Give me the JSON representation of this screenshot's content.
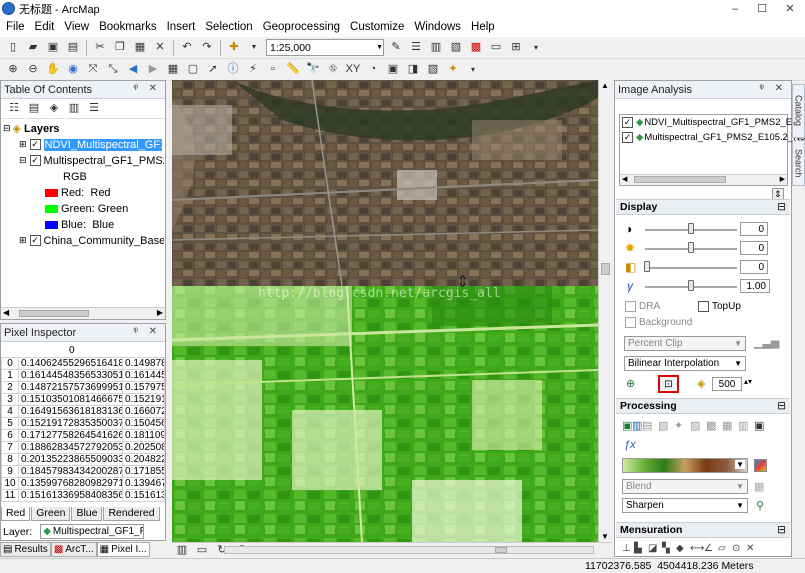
{
  "window": {
    "title": "无标题 - ArcMap",
    "min": "–",
    "max": "☐",
    "close": "✕"
  },
  "menu": [
    "File",
    "Edit",
    "View",
    "Bookmarks",
    "Insert",
    "Selection",
    "Geoprocessing",
    "Customize",
    "Windows",
    "Help"
  ],
  "toolbar": {
    "scale": "1:25,000"
  },
  "toc": {
    "title": "Table Of Contents",
    "layers_label": "Layers",
    "layer1": "NDVI_Multispectral_GF1_P",
    "layer2": "Multispectral_GF1_PMS2_E",
    "rgb": "RGB",
    "red": "Red:",
    "red_val": "Red",
    "green": "Green:",
    "green_val": "Green",
    "blue": "Blue:",
    "blue_val": "Blue",
    "layer3": "China_Community_BaseMa",
    "colors": {
      "red": "#ff0000",
      "green": "#00ff00",
      "blue": "#0000ff"
    }
  },
  "pixel": {
    "title": "Pixel Inspector",
    "col0": "0",
    "rows": [
      [
        "0",
        "0.1406245529651641​8",
        "0.1498782"
      ],
      [
        "1",
        "0.1614454835653305​1",
        "0.1614454"
      ],
      [
        "2",
        "0.1487215757369995​1",
        "0.1579753"
      ],
      [
        "3",
        "0.1510350108146667​5",
        "0.1521917"
      ],
      [
        "4",
        "0.1649156361818313​6",
        "0.1660723"
      ],
      [
        "5",
        "0.1521917283535003​7",
        "0.1504566"
      ],
      [
        "6",
        "0.1712775826454162​6",
        "0.1811096"
      ],
      [
        "7",
        "0.1886283457279205​3",
        "0.2025089"
      ],
      [
        "8",
        "0.2013522386550903​3",
        "0.2048224"
      ],
      [
        "9",
        "0.1845798343420028​7",
        "0.1718559"
      ],
      [
        "10",
        "0.1359976828098297​1",
        "0.1394678"
      ],
      [
        "11",
        "0.1516133695840835​6",
        "0.1516133"
      ]
    ],
    "tabs": [
      "Red",
      "Green",
      "Blue",
      "Rendered"
    ],
    "layer_label": "Layer:",
    "layer_value": "Multispectral_GF1_F"
  },
  "bottom_tabs": [
    "Results",
    "ArcT...",
    "Pixel I..."
  ],
  "watermark": "http://blog.csdn.net/arcgis_all",
  "image_analysis": {
    "title": "Image Analysis",
    "layers": [
      "NDVI_Multispectral_GF1_PMS2_E105",
      "Multispectral_GF1_PMS2_E105.2_N3"
    ],
    "display": "Display",
    "contrast": "0",
    "brightness": "0",
    "transparency": "0",
    "gamma": "1.00",
    "dra": "DRA",
    "topup": "TopUp",
    "background": "Background",
    "stretch": "Percent Clip",
    "resample": "Bilinear Interpolation",
    "zoom_value": "500",
    "processing": "Processing",
    "blend": "Blend",
    "sharpen": "Sharpen",
    "mensuration": "Mensuration"
  },
  "side_tabs": [
    "Catalog",
    "Search"
  ],
  "status": "11702376.585  4504418.236 Meters"
}
